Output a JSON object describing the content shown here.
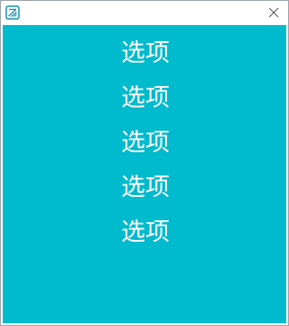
{
  "window": {
    "app_icon": "notebook-icon",
    "close_icon": "close-icon"
  },
  "colors": {
    "content_bg": "#00bacd",
    "text": "#ffffff",
    "icon": "#1a8fa8"
  },
  "menu": {
    "items": [
      {
        "label": "选项"
      },
      {
        "label": "选项"
      },
      {
        "label": "选项"
      },
      {
        "label": "选项"
      },
      {
        "label": "选项"
      }
    ]
  }
}
